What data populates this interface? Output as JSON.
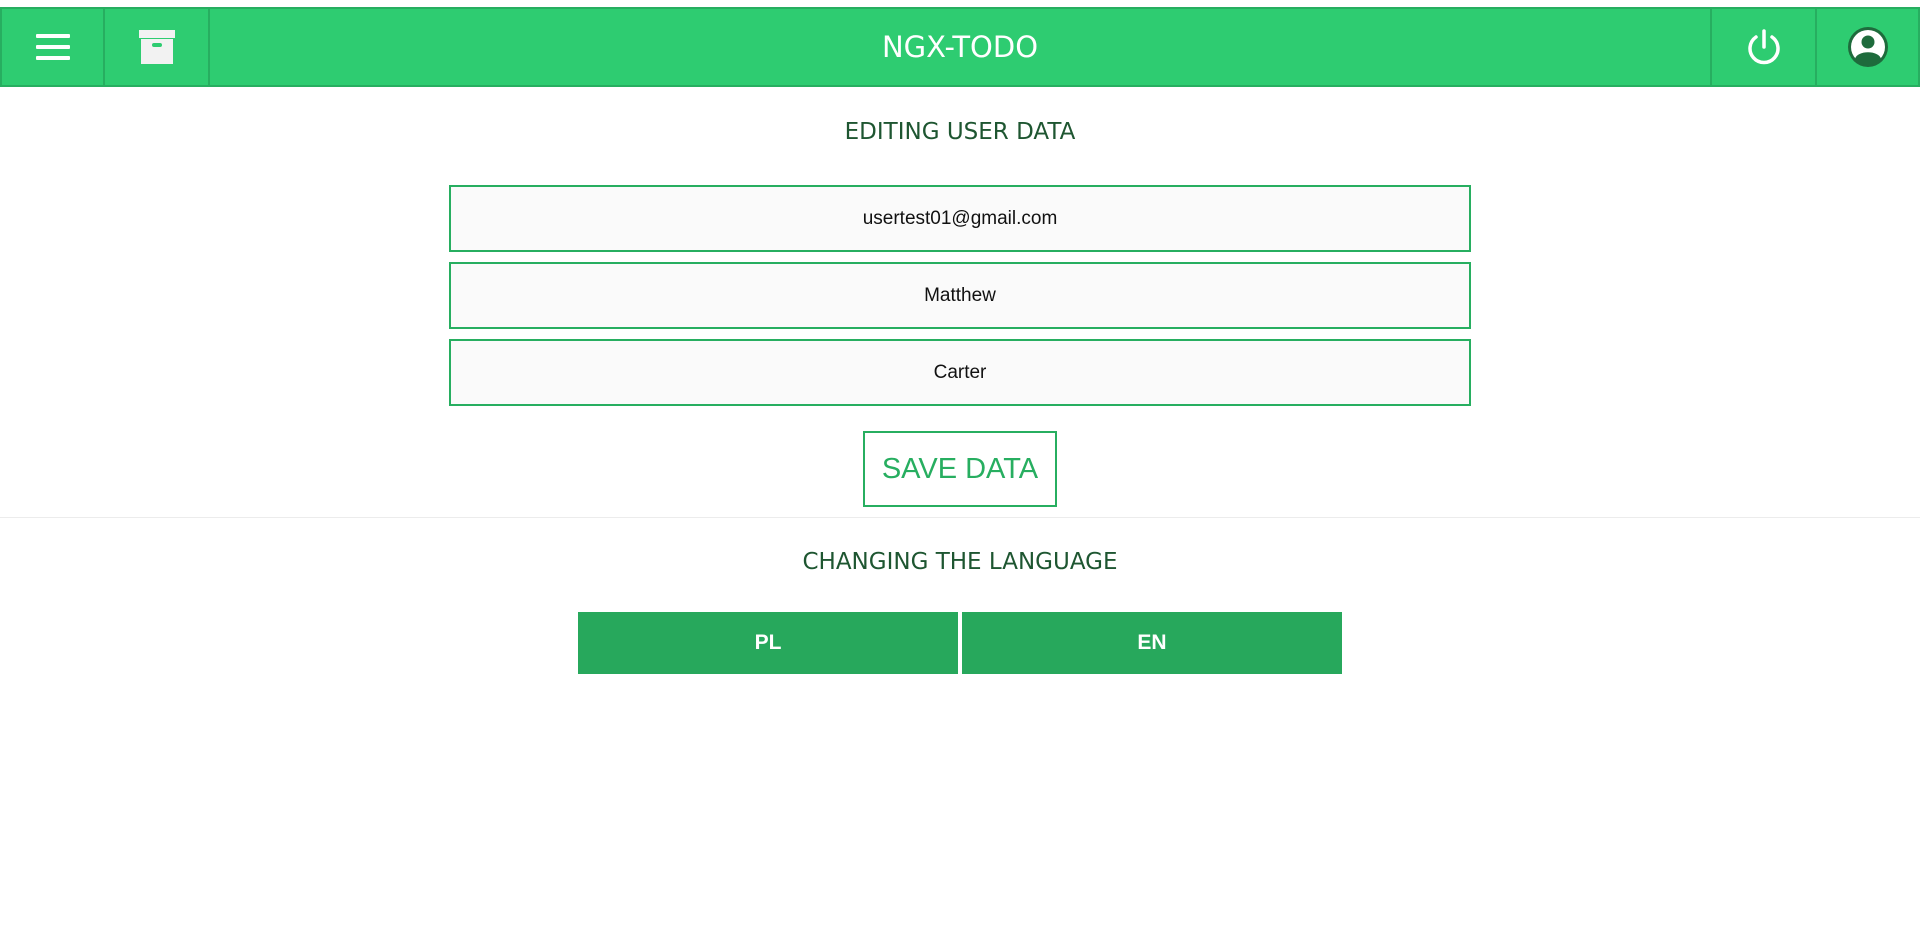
{
  "navbar": {
    "title": "NGX-TODO",
    "menu_icon": "hamburger-menu-icon",
    "archive_icon": "archive-box-icon",
    "power_icon": "power-icon",
    "user_icon": "user-account-icon"
  },
  "user_form": {
    "title": "EDITING USER DATA",
    "email_value": "usertest01@gmail.com",
    "first_name_value": "Matthew",
    "last_name_value": "Carter",
    "save_label": "SAVE DATA"
  },
  "language": {
    "title": "CHANGING THE LANGUAGE",
    "options": [
      "PL",
      "EN"
    ]
  },
  "colors": {
    "accent": "#2ecc71",
    "accent_dark": "#27ae60",
    "title_text": "#1e5631"
  }
}
